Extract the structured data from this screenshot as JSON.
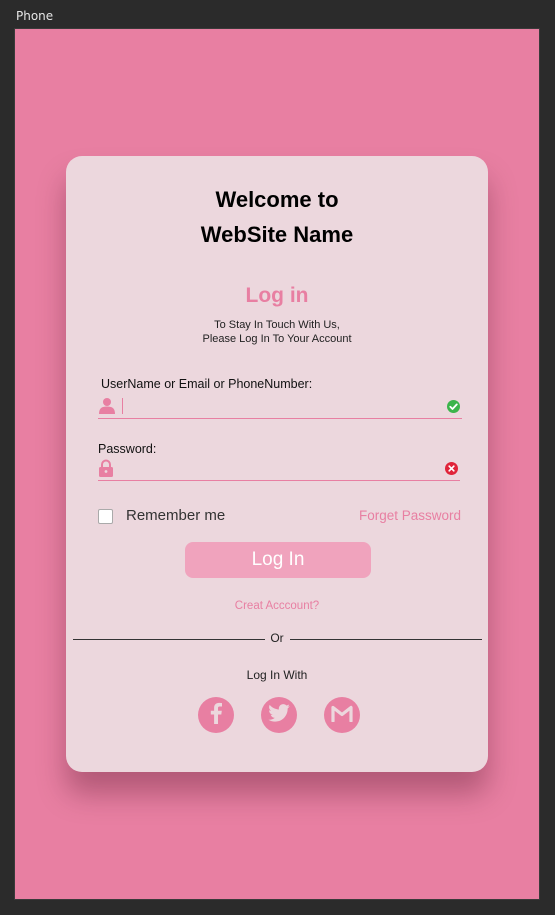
{
  "window": {
    "title": "Phone"
  },
  "colors": {
    "accent": "#e87fa2",
    "background": "#e87fa2",
    "card": "#ecd7dd",
    "button": "#f0a3bd",
    "success": "#3cb44b",
    "error": "#e0243a"
  },
  "header": {
    "line1": "Welcome to",
    "line2": "WebSite Name"
  },
  "login": {
    "heading": "Log in",
    "subtitle_line1": "To Stay In Touch With Us,",
    "subtitle_line2": "Please Log In To Your Account"
  },
  "form": {
    "username_label": "UserName or Email or PhoneNumber:",
    "username_value": "",
    "username_status": "valid",
    "password_label": "Password:",
    "password_value": "",
    "password_status": "invalid",
    "remember_label": "Remember me",
    "remember_checked": false,
    "forget_label": "Forget Password",
    "submit_label": "Log In",
    "create_label": "Creat Acccount?"
  },
  "divider": {
    "text": "Or"
  },
  "social": {
    "title": "Log In With",
    "icons": [
      "facebook-icon",
      "twitter-icon",
      "gmail-icon"
    ]
  }
}
